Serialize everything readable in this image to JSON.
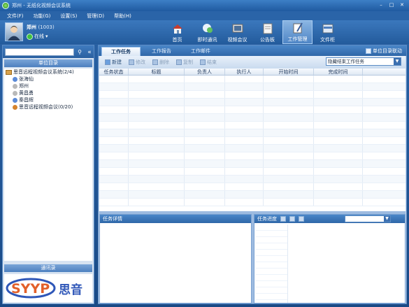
{
  "window": {
    "title": "郑州 - 无纸化视频会议系统"
  },
  "menu": [
    "文件(F)",
    "功能(G)",
    "设置(S)",
    "管理(D)",
    "帮助(H)"
  ],
  "user": {
    "name": "郑州",
    "id": "(1003)",
    "status": "在线"
  },
  "toolbar": [
    {
      "label": "首页",
      "icon": "home-icon"
    },
    {
      "label": "即时通讯",
      "icon": "chat-icon"
    },
    {
      "label": "视频会议",
      "icon": "video-icon"
    },
    {
      "label": "公告板",
      "icon": "board-icon"
    },
    {
      "label": "工作管理",
      "icon": "task-icon",
      "active": true
    },
    {
      "label": "文件柜",
      "icon": "cabinet-icon"
    }
  ],
  "left": {
    "search_placeholder": "",
    "section_title": "单位目录",
    "tree": [
      {
        "label": "思音远程视频会议系统(2/4)",
        "type": "root",
        "icon": "folder-icon"
      },
      {
        "label": "张海仙",
        "type": "child",
        "icon": "user-icon"
      },
      {
        "label": "郑州",
        "type": "child",
        "icon": "user-icon"
      },
      {
        "label": "黄昌勇",
        "type": "child",
        "icon": "user-icon"
      },
      {
        "label": "秦昌辉",
        "type": "child",
        "icon": "user-icon"
      },
      {
        "label": "思音远程视频会议(0/20)",
        "type": "child",
        "icon": "group-icon"
      }
    ],
    "contacts_title": "通讯录",
    "logo": {
      "text_en": "SYYP",
      "text_cn": "思音"
    }
  },
  "right": {
    "tabs": [
      "工作任务",
      "工作报告",
      "工作邮件"
    ],
    "dept_link": "单位目录联动",
    "actions": [
      {
        "label": "新建",
        "enabled": true
      },
      {
        "label": "修改",
        "enabled": false
      },
      {
        "label": "删除",
        "enabled": false
      },
      {
        "label": "复制",
        "enabled": false
      },
      {
        "label": "结束",
        "enabled": false
      }
    ],
    "filter_value": "隐藏结束工作任务",
    "columns": [
      "任务状态",
      "标题",
      "负责人",
      "执行人",
      "开始时间",
      "完成时间"
    ],
    "detail_title": "任务详情",
    "progress_title": "任务进度"
  },
  "colors": {
    "accent": "#2a64a8",
    "panel": "#c4d6ec",
    "online": "#3fbf3f"
  }
}
